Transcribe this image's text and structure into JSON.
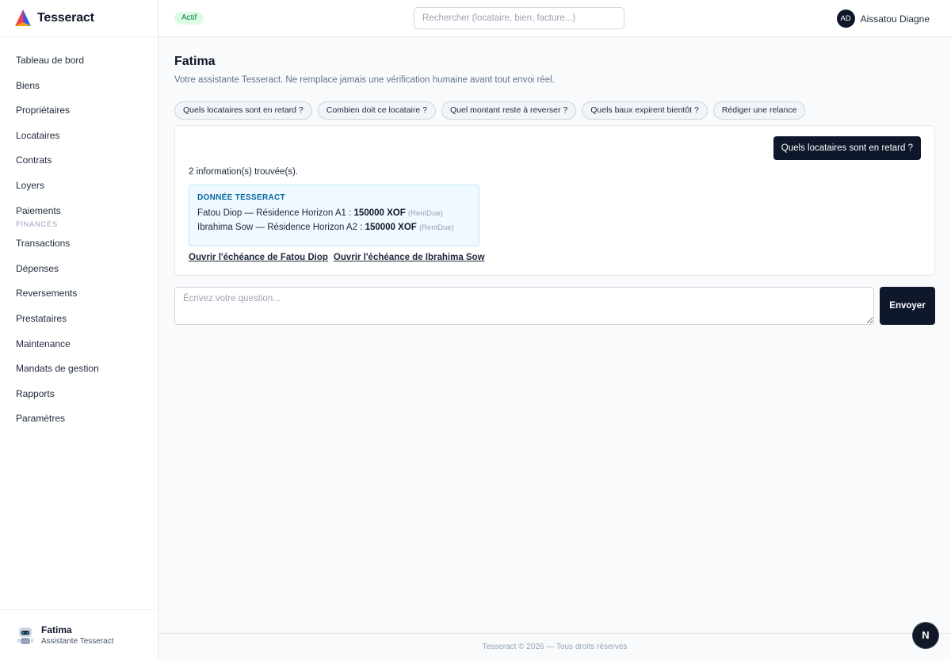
{
  "brand": {
    "name": "Tesseract"
  },
  "sidebar": {
    "items": [
      {
        "label": "Tableau de bord"
      },
      {
        "label": "Biens"
      },
      {
        "label": "Propriétaires"
      },
      {
        "label": "Locataires"
      },
      {
        "label": "Contrats"
      },
      {
        "label": "Loyers"
      },
      {
        "label": "Paiements"
      }
    ],
    "section_label": "FINANCES",
    "finance_items": [
      {
        "label": "Transactions"
      },
      {
        "label": "Dépenses"
      },
      {
        "label": "Reversements"
      },
      {
        "label": "Prestataires"
      },
      {
        "label": "Maintenance"
      },
      {
        "label": "Mandats de gestion"
      },
      {
        "label": "Rapports"
      },
      {
        "label": "Paramètres"
      }
    ],
    "footer": {
      "name": "Fatima",
      "role": "Assistante Tesseract"
    }
  },
  "header": {
    "status_badge": "Actif",
    "search_placeholder": "Rechercher (locataire, bien, facture...)",
    "user_initials": "AD",
    "user_name": "Aissatou Diagne"
  },
  "main": {
    "title": "Fatima",
    "subtitle": "Votre assistante Tesseract. Ne remplace jamais une vérification humaine avant tout envoi réel.",
    "suggestions": [
      "Quels locataires sont en retard ?",
      "Combien doit ce locataire ?",
      "Quel montant reste à reverser ?",
      "Quels baux expirent bientôt ?",
      "Rédiger une relance"
    ],
    "chat": {
      "user_message": "Quels locataires sont en retard ?",
      "result_count": "2 information(s) trouvée(s).",
      "card_title": "DONNÉE TESSERACT",
      "rows": [
        {
          "label": "Fatou Diop — Résidence Horizon A1 : ",
          "amount": "150000 XOF",
          "tag": "(RentDue)"
        },
        {
          "label": "Ibrahima Sow — Résidence Horizon A2 : ",
          "amount": "150000 XOF",
          "tag": "(RentDue)"
        }
      ],
      "links": [
        "Ouvrir l'échéance de Fatou Diop",
        "Ouvrir l'échéance de Ibrahima Sow"
      ]
    },
    "composer": {
      "placeholder": "Écrivez votre question...",
      "send_label": "Envoyer"
    }
  },
  "footer": {
    "text": "Tesseract © 2026 — Tous droits réservés"
  },
  "fab": {
    "label": "N"
  },
  "colors": {
    "primary": "#0f172a",
    "badge": "#dcfce7",
    "card": "#f0f9ff",
    "card_title": "#0369a1"
  }
}
